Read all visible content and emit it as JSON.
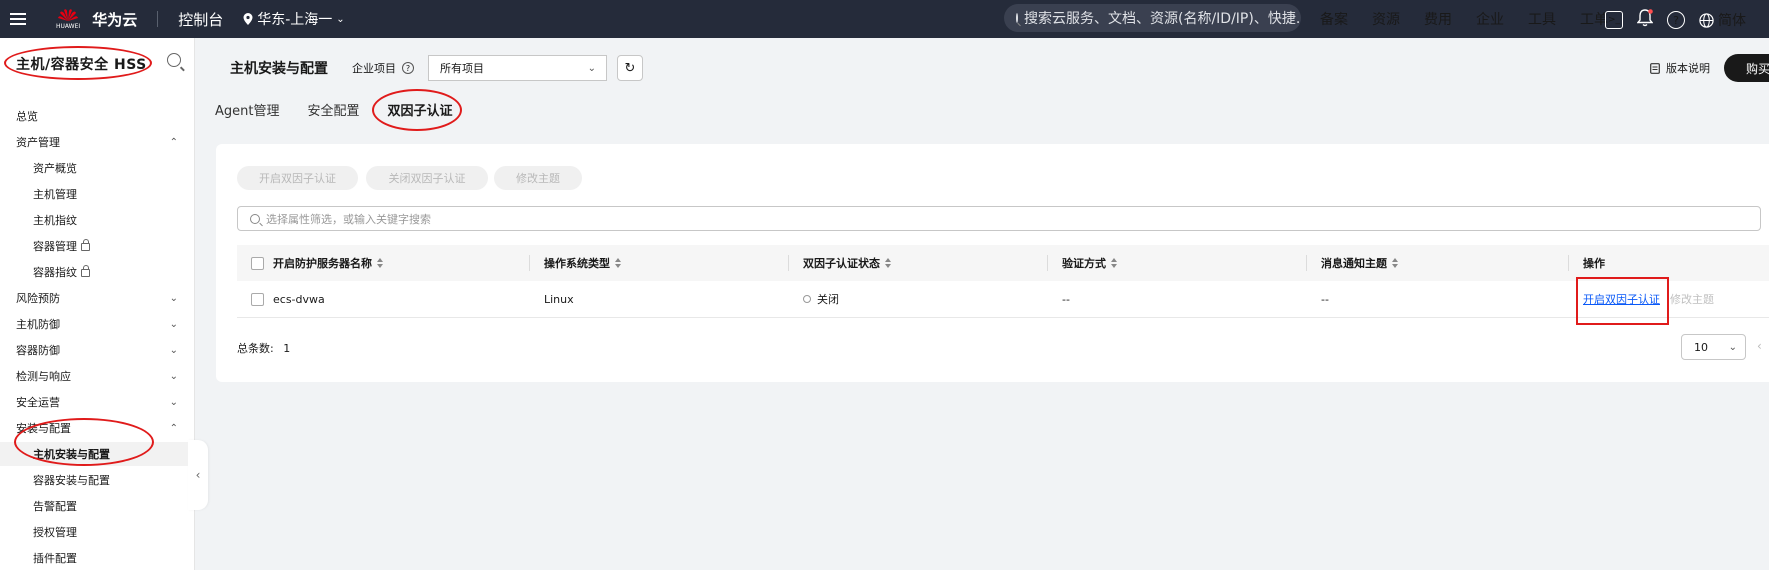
{
  "topbar": {
    "logo_text": "HUAWEI",
    "brand": "华为云",
    "console": "控制台",
    "region": "华东-上海一",
    "search_placeholder": "搜索云服务、文档、资源(名称/ID/IP)、快捷...",
    "links": [
      "备案",
      "资源",
      "费用",
      "企业",
      "工具",
      "工单"
    ],
    "lang": "简体"
  },
  "sidebar": {
    "title": "主机/容器安全 HSS",
    "items": [
      {
        "label": "总览",
        "level": 0
      },
      {
        "label": "资产管理",
        "level": 0,
        "chevron": "up"
      },
      {
        "label": "资产概览",
        "level": 1
      },
      {
        "label": "主机管理",
        "level": 1
      },
      {
        "label": "主机指纹",
        "level": 1
      },
      {
        "label": "容器管理",
        "level": 1,
        "lock": true
      },
      {
        "label": "容器指纹",
        "level": 1,
        "lock": true
      },
      {
        "label": "风险预防",
        "level": 0,
        "chevron": "down"
      },
      {
        "label": "主机防御",
        "level": 0,
        "chevron": "down"
      },
      {
        "label": "容器防御",
        "level": 0,
        "chevron": "down"
      },
      {
        "label": "检测与响应",
        "level": 0,
        "chevron": "down"
      },
      {
        "label": "安全运营",
        "level": 0,
        "chevron": "down"
      },
      {
        "label": "安装与配置",
        "level": 0,
        "chevron": "up"
      },
      {
        "label": "主机安装与配置",
        "level": 1,
        "active": true
      },
      {
        "label": "容器安装与配置",
        "level": 1
      },
      {
        "label": "告警配置",
        "level": 1
      },
      {
        "label": "授权管理",
        "level": 1
      },
      {
        "label": "插件配置",
        "level": 1
      }
    ]
  },
  "header": {
    "title": "主机安装与配置",
    "project_label": "企业项目",
    "project_value": "所有项目",
    "version_label": "版本说明",
    "buy_label": "购买"
  },
  "tabs": [
    {
      "label": "Agent管理",
      "active": false
    },
    {
      "label": "安全配置",
      "active": false
    },
    {
      "label": "双因子认证",
      "active": true
    }
  ],
  "toolbar": {
    "enable_label": "开启双因子认证",
    "disable_label": "关闭双因子认证",
    "modify_label": "修改主题"
  },
  "filter": {
    "placeholder": "选择属性筛选，或输入关键字搜索"
  },
  "table": {
    "columns": [
      "开启防护服务器名称",
      "操作系统类型",
      "双因子认证状态",
      "验证方式",
      "消息通知主题",
      "操作"
    ],
    "rows": [
      {
        "name": "ecs-dvwa",
        "os": "Linux",
        "status": "关闭",
        "method": "--",
        "topic": "--",
        "action_enable": "开启双因子认证",
        "action_modify": "修改主题"
      }
    ]
  },
  "footer": {
    "total_label": "总条数:",
    "total_value": "1",
    "page_size": "10"
  },
  "colors": {
    "topbar_bg": "#252b3a",
    "link_blue": "#0a59f7",
    "annotation_red": "#e01b1b"
  }
}
